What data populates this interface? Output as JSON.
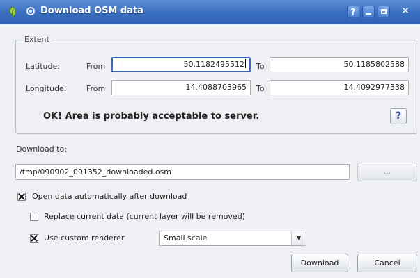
{
  "window": {
    "title": "Download OSM data",
    "controls": {
      "help": "?",
      "close": "✕"
    }
  },
  "extent": {
    "legend": "Extent",
    "latitude_label": "Latitude:",
    "longitude_label": "Longitude:",
    "from_label": "From",
    "to_label": "To",
    "lat_from": "50.1182495512",
    "lat_to": "50.1185802588",
    "lon_from": "14.4088703965",
    "lon_to": "14.4092977338",
    "status": "OK! Area is probably acceptable to server.",
    "help_button": "?"
  },
  "download": {
    "label": "Download to:",
    "path": "/tmp/090902_091352_downloaded.osm",
    "browse_label": "..."
  },
  "options": {
    "open_auto": {
      "label": "Open data automatically after download",
      "checked": true
    },
    "replace": {
      "label": "Replace current data (current layer will be removed)",
      "checked": false
    },
    "custom_renderer": {
      "label": "Use custom renderer",
      "checked": true
    },
    "renderer_value": "Small scale"
  },
  "buttons": {
    "download": "Download",
    "cancel": "Cancel"
  },
  "colors": {
    "titlebar": "#3a6fc0",
    "focus": "#3c66c9"
  }
}
